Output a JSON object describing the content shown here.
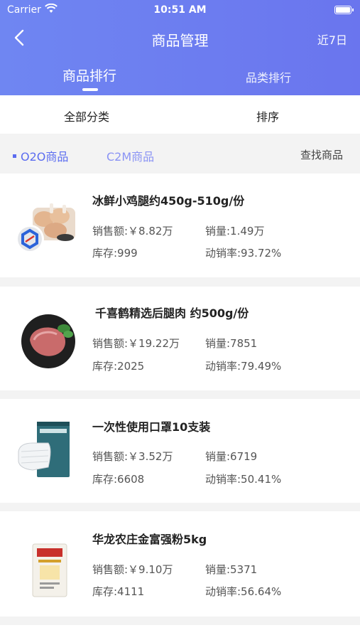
{
  "status_bar": {
    "carrier": "Carrier",
    "time": "10:51 AM"
  },
  "nav": {
    "title": "商品管理",
    "range_label": "近7日"
  },
  "tabs": [
    {
      "label": "商品排行"
    },
    {
      "label": "品类排行"
    }
  ],
  "filters": {
    "category": "全部分类",
    "sort": "排序"
  },
  "subtabs": {
    "o2o": "O2O商品",
    "c2m": "C2M商品",
    "search": "查找商品"
  },
  "products": [
    {
      "name": "冰鲜小鸡腿约450g-510g/份",
      "sales": "销售额:￥8.82万",
      "volume": "销量:1.49万",
      "stock": "库存:999",
      "turnover": "动销率:93.72%"
    },
    {
      "name": "千喜鹤精选后腿肉 约500g/份",
      "sales": "销售额:￥19.22万",
      "volume": "销量:7851",
      "stock": "库存:2025",
      "turnover": "动销率:79.49%"
    },
    {
      "name": "一次性使用口罩10支装",
      "sales": "销售额:￥3.52万",
      "volume": "销量:6719",
      "stock": "库存:6608",
      "turnover": "动销率:50.41%"
    },
    {
      "name": "华龙农庄金富强粉5kg",
      "sales": "销售额:￥9.10万",
      "volume": "销量:5371",
      "stock": "库存:4111",
      "turnover": "动销率:56.64%"
    }
  ],
  "colors": {
    "header_gradient_start": "#6f86f2",
    "header_gradient_end": "#6a75ee",
    "accent": "#5b6cf0"
  }
}
